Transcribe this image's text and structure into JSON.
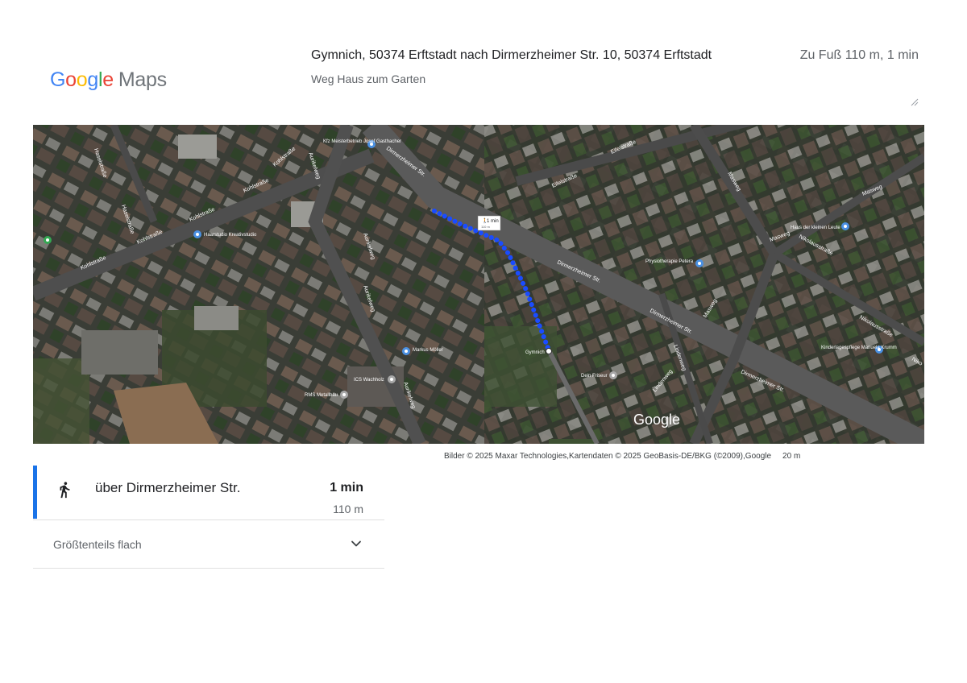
{
  "header": {
    "logo_google": "Google",
    "logo_maps": "Maps",
    "route_title": "Gymnich, 50374 Erftstadt nach Dirmerzheimer Str. 10, 50374 Erftstadt",
    "route_subtitle": "Weg Haus zum Garten",
    "route_summary": "Zu Fuß 110 m, 1 min"
  },
  "map": {
    "view": "satellite",
    "watermark": "Google",
    "route_color": "#1a4cff",
    "callout": {
      "time": "1 min",
      "distance": "110 m"
    },
    "start_label": "Gymnich",
    "streets": [
      "Kohlstraße",
      "Kohlstraße",
      "Kohlstraße",
      "Kohlstraße",
      "Kohlstraße",
      "Dirmerzheimer Str.",
      "Dirmerzheimer Str.",
      "Dirmerzheimer Str.",
      "Dirmerzheimer Str.",
      "Aurikelweg",
      "Aurikelweg",
      "Aurikelweg",
      "Aurikelweg",
      "Eifelstraße",
      "Eifelstraße",
      "Masweg",
      "Masweg",
      "Masweg",
      "Masweg",
      "Nikolausstraße",
      "Nikolausstraße",
      "Lindenweg",
      "Lindenweg",
      "Haselstraße",
      "Haselstraße",
      "Niko"
    ],
    "pois": [
      "Kfz Meisterbetrieb Josef Gasthacher",
      "Haarstudio Kreativstudio",
      "Haus der kleinen Leute",
      "Physiotherapie Petera",
      "Markus Möller",
      "ICS Wachholz",
      "RMS Metallbau",
      "Dein Friseur",
      "Kinderlagespflege Manuela Krumm"
    ]
  },
  "attribution": {
    "text": "Bilder © 2025 Maxar Technologies,Kartendaten © 2025 GeoBasis-DE/BKG (©2009),Google",
    "scale": "20 m"
  },
  "steps": [
    {
      "mode": "walking-icon",
      "via": "über Dirmerzheimer Str.",
      "time": "1 min",
      "distance": "110 m"
    }
  ],
  "terrain": {
    "label": "Größtenteils flach",
    "expand_icon": "chevron-down-icon"
  },
  "colors": {
    "accent": "#1a73e8",
    "route": "#1a4cff"
  }
}
